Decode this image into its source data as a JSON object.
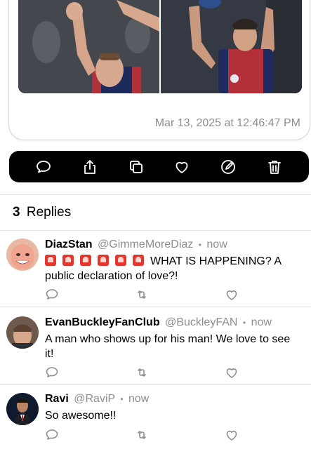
{
  "post": {
    "timestamp": "Mar 13, 2025 at 12:46:47 PM",
    "images": [
      {
        "icon": "basketball-player-photo-left"
      },
      {
        "icon": "basketball-player-photo-right"
      }
    ]
  },
  "action_bar": {
    "icons": [
      "comment-icon",
      "share-icon",
      "copy-icon",
      "heart-icon",
      "edit-icon",
      "trash-icon"
    ]
  },
  "replies_header": {
    "count": "3",
    "label": "Replies"
  },
  "replies": [
    {
      "author": "DiazStan",
      "handle": "@GimmeMoreDiaz",
      "separator": "•",
      "time": "now",
      "emoji": "🚨 🚨 🚨 🚨 🚨 🚨",
      "text": "WHAT IS HAPPENING? A public declaration of love?!"
    },
    {
      "author": "EvanBuckleyFanClub",
      "handle": "@BuckleyFAN",
      "separator": "•",
      "time": "now",
      "text": "A man who shows up for his man! We love to see it!"
    },
    {
      "author": "Ravi",
      "handle": "@RaviP",
      "separator": "•",
      "time": "now",
      "text": "So awesome!!"
    }
  ],
  "colors": {
    "secondary_text": "#8e8e93",
    "action_bar_bg": "#000000",
    "siren": "#e5352d"
  }
}
